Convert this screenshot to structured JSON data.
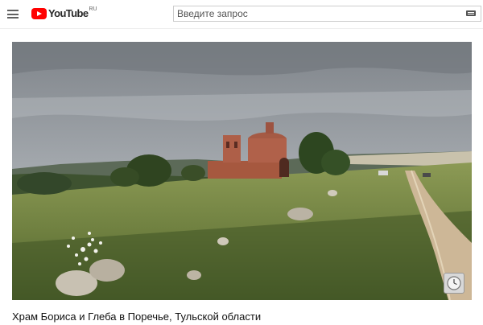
{
  "header": {
    "logo_text": "YouTube",
    "logo_region": "RU",
    "search_placeholder": "Введите запрос"
  },
  "icons": [
    "menu-icon",
    "youtube-logo-icon",
    "keyboard-icon",
    "clock-icon"
  ],
  "video": {
    "title": "Храм Бориса и Глеба в Поречье, Тульской области"
  },
  "colors": {
    "brand": "#ff0000",
    "sky": "#9aa0a6",
    "grass": "#7a8a45"
  }
}
